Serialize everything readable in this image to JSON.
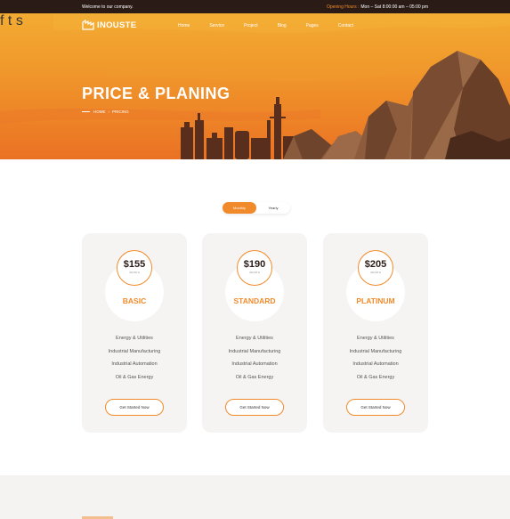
{
  "topbar": {
    "welcome": "Welcome to our company.",
    "hours_label": "Opening Hours :",
    "hours_value": "Mon – Sat 8:00:00 am – 05:00 pm"
  },
  "brand": {
    "name": "INOUSTE"
  },
  "nav": {
    "items": [
      "Home",
      "Service",
      "Project",
      "Blog",
      "Pages",
      "Contact"
    ]
  },
  "social": [
    {
      "icon": "facebook-icon",
      "glyph": "f"
    },
    {
      "icon": "twitter-icon",
      "glyph": "t"
    },
    {
      "icon": "skype-icon",
      "glyph": "s"
    }
  ],
  "hero": {
    "title": "PRICE & PLANING",
    "breadcrumb": {
      "home": "HOME",
      "separator": "›",
      "current": "PRICING"
    }
  },
  "billing_toggle": {
    "active": "Monthly",
    "other": "Yearly"
  },
  "plans": [
    {
      "price": "$155",
      "period": "/MONTH",
      "name": "BASIC",
      "features": [
        "Energy & Utilities",
        "Industrial Manufacturing",
        "Industrial Automation",
        "Oil & Gas Energy"
      ],
      "cta": "Get Started Now"
    },
    {
      "price": "$190",
      "period": "/MONTH",
      "name": "STANDARD",
      "features": [
        "Energy & Utilities",
        "Industrial Manufacturing",
        "Industrial Automation",
        "Oil & Gas Energy"
      ],
      "cta": "Get Started Now"
    },
    {
      "price": "$205",
      "period": "/MONTH",
      "name": "PLATINUM",
      "features": [
        "Energy & Utilities",
        "Industrial Manufacturing",
        "Industrial Automation",
        "Oil & Gas Energy"
      ],
      "cta": "Get Started Now"
    }
  ],
  "colors": {
    "accent": "#f18a2a",
    "dark": "#2a1b17",
    "card_bg": "#f6f4f2"
  }
}
